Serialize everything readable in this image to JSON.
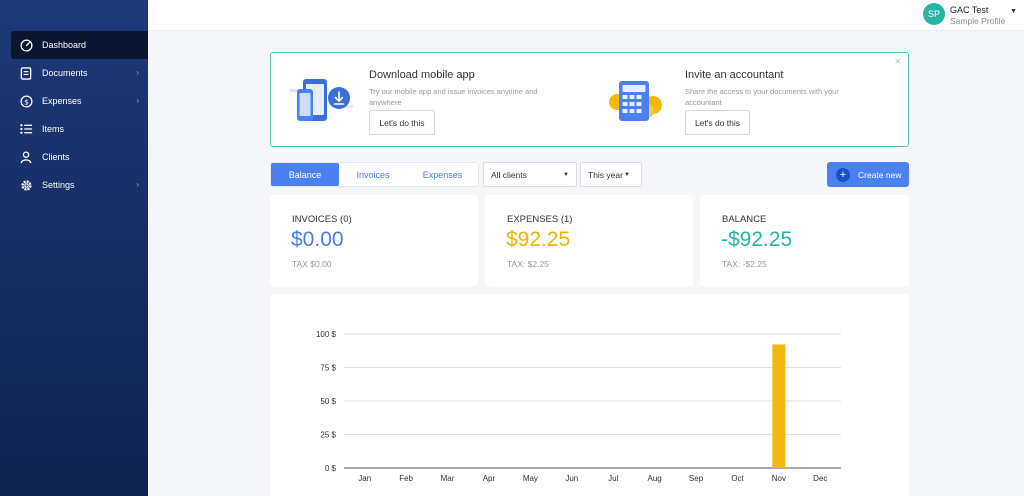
{
  "sidebar": {
    "items": [
      {
        "label": "Dashboard",
        "icon": "dashboard-gauge-icon",
        "active": true,
        "has_children": false
      },
      {
        "label": "Documents",
        "icon": "document-icon",
        "active": false,
        "has_children": true
      },
      {
        "label": "Expenses",
        "icon": "dollar-icon",
        "active": false,
        "has_children": true
      },
      {
        "label": "Items",
        "icon": "list-icon",
        "active": false,
        "has_children": false
      },
      {
        "label": "Clients",
        "icon": "user-icon",
        "active": false,
        "has_children": false
      },
      {
        "label": "Settings",
        "icon": "gear-icon",
        "active": false,
        "has_children": true
      }
    ]
  },
  "user": {
    "initials": "SP",
    "name": "GAC Test",
    "profile": "Sample Profile"
  },
  "promo": {
    "app": {
      "title": "Download mobile app",
      "desc": "Try our mobile app and issue invoices anytime and anywhere",
      "button": "Let's do this"
    },
    "accountant": {
      "title": "Invite an accountant",
      "desc": "Share the access to your documents with your accountant",
      "button": "Let's do this"
    },
    "close": "×"
  },
  "tabs": [
    "Balance",
    "Invoices",
    "Expenses"
  ],
  "filters": {
    "clients": "All clients",
    "period": "This year"
  },
  "create_button": "Create new",
  "cards": {
    "invoices": {
      "label": "INVOICES (0)",
      "value": "$0.00",
      "tax": "TAX $0.00",
      "color": "#4a7fe0"
    },
    "expenses": {
      "label": "EXPENSES (1)",
      "value": "$92.25",
      "tax": "TAX: $2.25",
      "color": "#f0b400"
    },
    "balance": {
      "label": "BALANCE",
      "value": "-$92.25",
      "tax": "TAX: -$2.25",
      "color": "#26b5a4"
    }
  },
  "colors": {
    "accent": "#4a80f0",
    "teal": "#26b5a4",
    "bar": "#f3b90d"
  },
  "chart_data": {
    "type": "bar",
    "categories": [
      "Jan",
      "Feb",
      "Mar",
      "Apr",
      "May",
      "Jun",
      "Jul",
      "Aug",
      "Sep",
      "Oct",
      "Nov",
      "Dec"
    ],
    "values": [
      0,
      0,
      0,
      0,
      0,
      0,
      0,
      0,
      0,
      0,
      92.25,
      0
    ],
    "yticks": [
      "0 $",
      "25 $",
      "50 $",
      "75 $",
      "100 $"
    ],
    "ylim": [
      0,
      100
    ],
    "grid": true
  }
}
